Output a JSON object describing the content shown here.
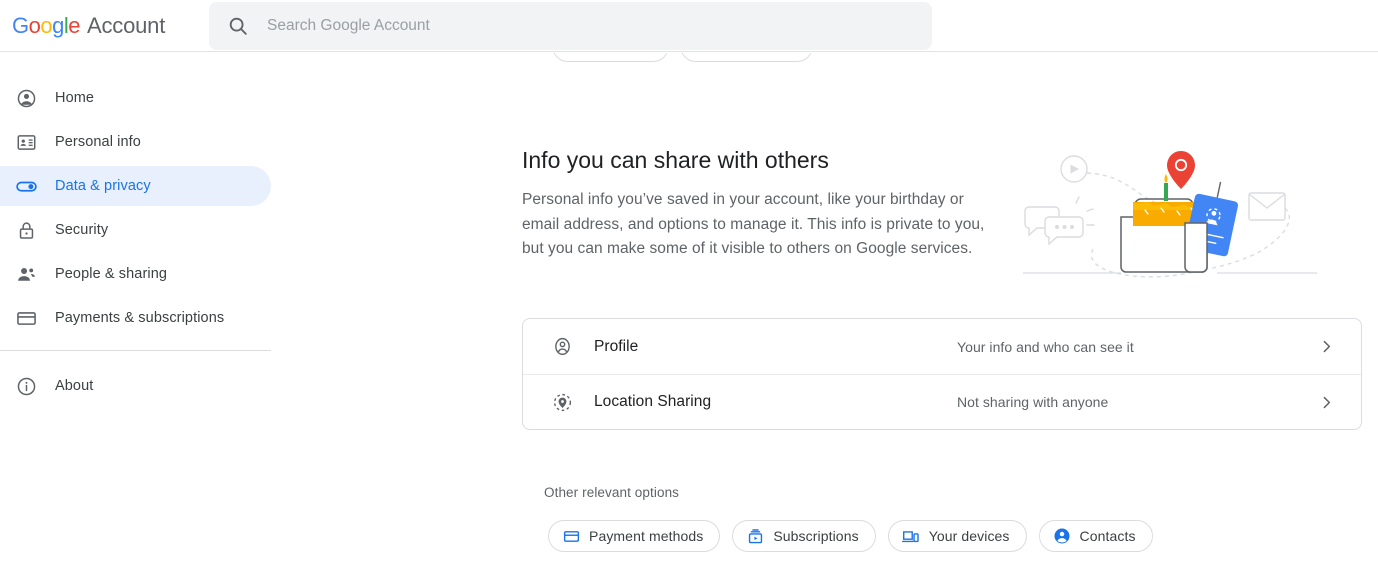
{
  "header": {
    "logo_text": "Google",
    "product_name": "Account",
    "search": {
      "icon": "search-icon",
      "placeholder": "Search Google Account",
      "value": ""
    }
  },
  "sidebar": {
    "items": [
      {
        "label": "Home",
        "icon": "account-circle-icon",
        "active": false
      },
      {
        "label": "Personal info",
        "icon": "contact-card-icon",
        "active": false
      },
      {
        "label": "Data & privacy",
        "icon": "toggle-on-icon",
        "active": true
      },
      {
        "label": "Security",
        "icon": "lock-icon",
        "active": false
      },
      {
        "label": "People & sharing",
        "icon": "people-icon",
        "active": false
      },
      {
        "label": "Payments & subscriptions",
        "icon": "credit-card-icon",
        "active": false
      }
    ],
    "footer_items": [
      {
        "label": "About",
        "icon": "info-icon",
        "active": false
      }
    ]
  },
  "main": {
    "hero": {
      "title": "Info you can share with others",
      "description": "Personal info you’ve saved in your account, like your birthday or email address, and options to manage it. This info is private to you, but you can make some of it visible to others on Google services.",
      "illustration": "share-info-illustration"
    },
    "card_rows": [
      {
        "title": "Profile",
        "value": "Your info and who can see it",
        "icon": "account-circle-outline-icon",
        "chevron": "chevron-right-icon"
      },
      {
        "title": "Location Sharing",
        "value": "Not sharing with anyone",
        "icon": "location-pin-dashed-icon",
        "chevron": "chevron-right-icon"
      }
    ],
    "other_options": {
      "label": "Other relevant options",
      "chips": [
        {
          "label": "Payment methods",
          "icon": "credit-card-icon"
        },
        {
          "label": "Subscriptions",
          "icon": "subscriptions-icon"
        },
        {
          "label": "Your devices",
          "icon": "devices-icon"
        },
        {
          "label": "Contacts",
          "icon": "account-circle-filled-icon"
        }
      ]
    }
  },
  "colors": {
    "google_blue": "#4285f4",
    "google_red": "#ea4335",
    "google_yellow": "#fbbc05",
    "google_green": "#34a853",
    "accent_blue": "#1a73e8",
    "active_pill_bg": "#e8f0fe",
    "text_primary": "#202124",
    "text_secondary": "#5f6368",
    "border": "#dadce0"
  }
}
